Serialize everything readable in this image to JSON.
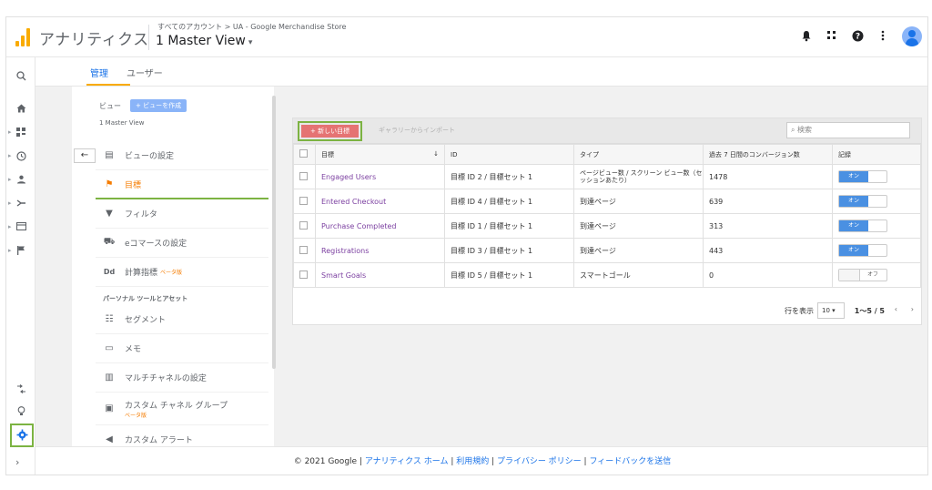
{
  "header": {
    "app_name": "アナリティクス",
    "breadcrumb": "すべてのアカウント > UA - Google Merchandise Store",
    "view_name": "1 Master View"
  },
  "icons": {
    "notifications": "bell-icon",
    "apps": "apps-grid-icon",
    "help": "help-icon",
    "more": "more-vert-icon"
  },
  "tabs": {
    "admin": "管理",
    "user": "ユーザー"
  },
  "view_column": {
    "view_label": "ビュー",
    "create_view": "+ ビューを作成",
    "selected_view": "1 Master View",
    "menu": [
      {
        "label": "ビューの設定",
        "icon": "document-icon"
      },
      {
        "label": "目標",
        "icon": "flag-icon"
      },
      {
        "label": "フィルタ",
        "icon": "filter-icon"
      },
      {
        "label": "eコマースの設定",
        "icon": "cart-icon"
      },
      {
        "label": "計算指標",
        "icon": "calc-icon",
        "badge": "ベータ版"
      }
    ],
    "section_title": "パーソナル ツールとアセット",
    "tools": [
      {
        "label": "セグメント",
        "icon": "segment-icon"
      },
      {
        "label": "メモ",
        "icon": "note-icon"
      },
      {
        "label": "マルチチャネルの設定",
        "icon": "chart-icon"
      },
      {
        "label": "カスタム チャネル グループ",
        "icon": "channel-group-icon",
        "badge": "ベータ版"
      },
      {
        "label": "カスタム アラート",
        "icon": "megaphone-icon"
      }
    ]
  },
  "toolbar": {
    "new_goal": "+ 新しい目標",
    "import": "ギャラリーからインポート",
    "search_placeholder": "検索"
  },
  "table": {
    "headers": [
      "目標",
      "ID",
      "タイプ",
      "過去 7 日間のコンバージョン数",
      "記録"
    ],
    "rows": [
      {
        "goal": "Engaged Users",
        "id": "目標 ID 2 / 目標セット 1",
        "type": "ページビュー数 / スクリーン ビュー数（セッションあたり）",
        "conversions": "1478",
        "recording": "オン"
      },
      {
        "goal": "Entered Checkout",
        "id": "目標 ID 4 / 目標セット 1",
        "type": "到達ページ",
        "conversions": "639",
        "recording": "オン"
      },
      {
        "goal": "Purchase Completed",
        "id": "目標 ID 1 / 目標セット 1",
        "type": "到達ページ",
        "conversions": "313",
        "recording": "オン"
      },
      {
        "goal": "Registrations",
        "id": "目標 ID 3 / 目標セット 1",
        "type": "到達ページ",
        "conversions": "443",
        "recording": "オン"
      },
      {
        "goal": "Smart Goals",
        "id": "目標 ID 5 / 目標セット 1",
        "type": "スマートゴール",
        "conversions": "0",
        "recording": "オフ"
      }
    ]
  },
  "pager": {
    "rows_label": "行を表示",
    "rows_value": "10",
    "range": "1～5 / 5",
    "prev": "‹",
    "next": "›"
  },
  "footer": {
    "copyright": "© 2021 Google",
    "links": [
      "アナリティクス ホーム",
      "利用規約",
      "プライバシー ポリシー",
      "フィードバックを送信"
    ]
  },
  "colors": {
    "accent": "#1a73e8",
    "highlight_green": "#7cb342",
    "goal_link": "#7b3fa0",
    "new_goal_button": "#e57373",
    "toggle_on": "#4a90e2",
    "active_menu": "#f57c00"
  }
}
